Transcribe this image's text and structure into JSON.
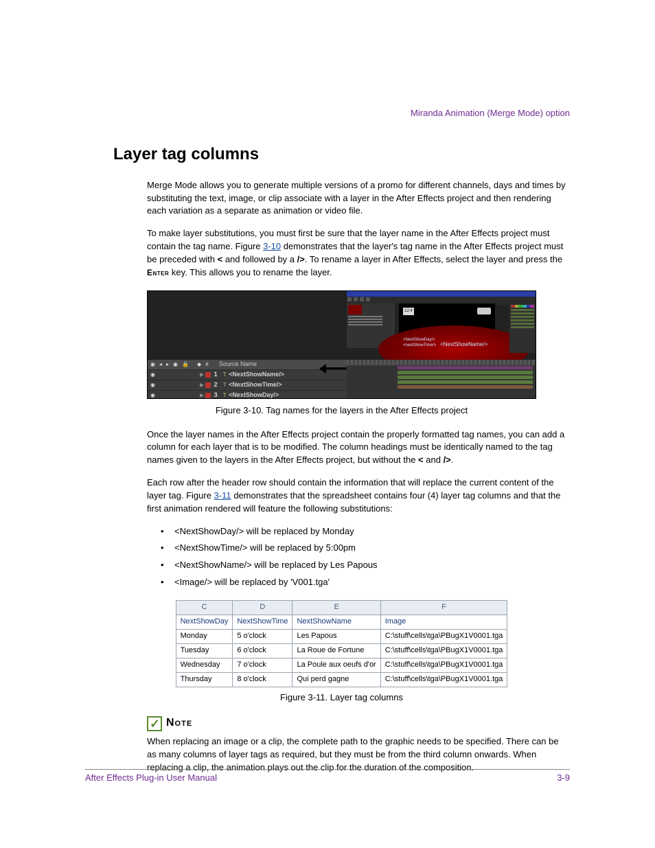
{
  "header": {
    "section": "Miranda Animation (Merge Mode) option"
  },
  "h1": "Layer tag columns",
  "para1": "Merge Mode allows you to generate multiple versions of a promo for different channels, days and times by substituting the text, image, or clip associate with a layer in the After Effects project and then rendering each variation as a separate as animation or video file.",
  "para2a": "To make layer substitutions, you must first be sure that the layer name in the After Effects project must contain the tag name. Figure ",
  "para2link": "3-10",
  "para2b": " demonstrates that the layer's tag name in the After Effects project must be preceded with ",
  "para2lt": "<",
  "para2c": " and followed by a ",
  "para2gt": "/>",
  "para2d": ". To rename a layer in After Effects, select the layer and press the ",
  "enter": "Enter",
  "para2e": " key. This allows you to rename the layer.",
  "fig310": {
    "caption": "Figure 3-10. Tag names for the layers in the After Effects project",
    "clock": "12:4",
    "previewTags": {
      "day": "<NextShowDay/>",
      "time": "<nextShowTime/>",
      "name": "<NextShowName/>"
    },
    "sourceName": "Source Name",
    "headerIcons": [
      "◉",
      "◂",
      "▸",
      "◉",
      "🔒",
      "",
      "◆",
      "#"
    ],
    "layers": [
      {
        "num": "1",
        "name": "<NextShowName/>"
      },
      {
        "num": "2",
        "name": "<NextShowTime/>"
      },
      {
        "num": "3",
        "name": "<NextShowDay/>"
      }
    ]
  },
  "para3a": "Once the layer names in the After Effects project contain the properly formatted tag names, you can add a column for each layer that is to be modified. The column headings must be identically named to the tag names given to the layers in the After Effects project, but without the ",
  "para3lt": "<",
  "para3b": " and ",
  "para3gt": "/>",
  "para3c": ".",
  "para4a": "Each row after the header row should contain the information that will replace the current content of the layer tag. Figure ",
  "para4link": "3-11",
  "para4b": " demonstrates that the spreadsheet contains four (4) layer tag columns and that the first animation rendered will feature the following substitutions:",
  "bullets": [
    "<NextShowDay/> will be replaced by Monday",
    "<NextShowTime/> will be replaced by 5:00pm",
    "<NextShowName/> will be replaced by Les Papous",
    "<Image/> will be replaced by 'V001.tga'"
  ],
  "fig311": {
    "caption": "Figure 3-11. Layer tag columns",
    "cols": [
      "C",
      "D",
      "E",
      "F"
    ],
    "headers": [
      "NextShowDay",
      "NextShowTime",
      "NextShowName",
      "Image"
    ],
    "rows": [
      [
        "Monday",
        "5 o'clock",
        "Les Papous",
        "C:\\stuff\\cells\\tga\\PBugX1V0001.tga"
      ],
      [
        "Tuesday",
        "6 o'clock",
        "La Roue de Fortune",
        "C:\\stuff\\cells\\tga\\PBugX1V0001.tga"
      ],
      [
        "Wednesday",
        "7 o'clock",
        "La Poule aux oeufs d'or",
        "C:\\stuff\\cells\\tga\\PBugX1V0001.tga"
      ],
      [
        "Thursday",
        "8 o'clock",
        "Qui perd gagne",
        "C:\\stuff\\cells\\tga\\PBugX1V0001.tga"
      ]
    ]
  },
  "noteLabel": "Note",
  "noteText": "When replacing an image or a clip, the complete path to the graphic needs to be specified. There can be as many columns of layer tags as required, but they must be from the third column onwards. When replacing a clip, the animation plays out the clip for the duration of the composition.",
  "footer": {
    "left": "After Effects Plug-in User Manual",
    "right": "3-9"
  }
}
